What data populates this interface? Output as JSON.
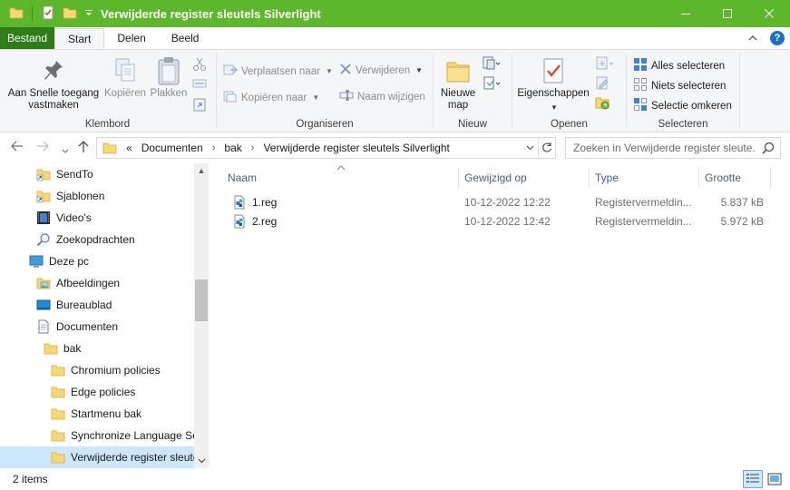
{
  "window": {
    "title": "Verwijderde register sleutels Silverlight",
    "accent": "#5cb82a"
  },
  "ribbon_tabs": {
    "file": "Bestand",
    "start": "Start",
    "share": "Delen",
    "view": "Beeld"
  },
  "ribbon": {
    "klembord": {
      "label": "Klembord",
      "pin_line1": "Aan Snelle toegang",
      "pin_line2": "vastmaken",
      "copy": "Kopiëren",
      "paste": "Plakken"
    },
    "organiseren": {
      "label": "Organiseren",
      "move_to": "Verplaatsen naar",
      "copy_to": "Kopiëren naar",
      "delete": "Verwijderen",
      "rename": "Naam wijzigen"
    },
    "nieuw": {
      "label": "Nieuw",
      "new_folder_line1": "Nieuwe",
      "new_folder_line2": "map"
    },
    "openen": {
      "label": "Openen",
      "properties": "Eigenschappen"
    },
    "selecteren": {
      "label": "Selecteren",
      "select_all": "Alles selecteren",
      "select_none": "Niets selecteren",
      "invert": "Selectie omkeren"
    }
  },
  "address": {
    "overflow": "«",
    "crumbs": [
      "Documenten",
      "bak",
      "Verwijderde register sleutels Silverlight"
    ]
  },
  "search": {
    "placeholder": "Zoeken in Verwijderde register sleute..."
  },
  "nav_tree": [
    {
      "label": "SendTo",
      "icon": "folder-shortcut-icon"
    },
    {
      "label": "Sjablonen",
      "icon": "folder-shortcut-icon"
    },
    {
      "label": "Video's",
      "icon": "videos-icon"
    },
    {
      "label": "Zoekopdrachten",
      "icon": "search-icon"
    },
    {
      "label": "Deze pc",
      "icon": "computer-icon"
    },
    {
      "label": "Afbeeldingen",
      "icon": "pictures-icon"
    },
    {
      "label": "Bureaublad",
      "icon": "desktop-icon"
    },
    {
      "label": "Documenten",
      "icon": "documents-icon"
    },
    {
      "label": "bak",
      "icon": "folder-icon"
    },
    {
      "label": "Chromium policies",
      "icon": "folder-icon"
    },
    {
      "label": "Edge policies",
      "icon": "folder-icon"
    },
    {
      "label": "Startmenu bak",
      "icon": "folder-icon"
    },
    {
      "label": "Synchronize Language Se",
      "icon": "folder-icon"
    },
    {
      "label": "Verwijderde register sleute",
      "icon": "folder-icon"
    }
  ],
  "columns": {
    "name": "Naam",
    "modified": "Gewijzigd op",
    "type": "Type",
    "size": "Grootte"
  },
  "files": [
    {
      "name": "1.reg",
      "modified": "10-12-2022 12:22",
      "type": "Registervermeldin...",
      "size": "5.837 kB"
    },
    {
      "name": "2.reg",
      "modified": "10-12-2022 12:42",
      "type": "Registervermeldin...",
      "size": "5.972 kB"
    }
  ],
  "status": {
    "count": "2 items"
  }
}
